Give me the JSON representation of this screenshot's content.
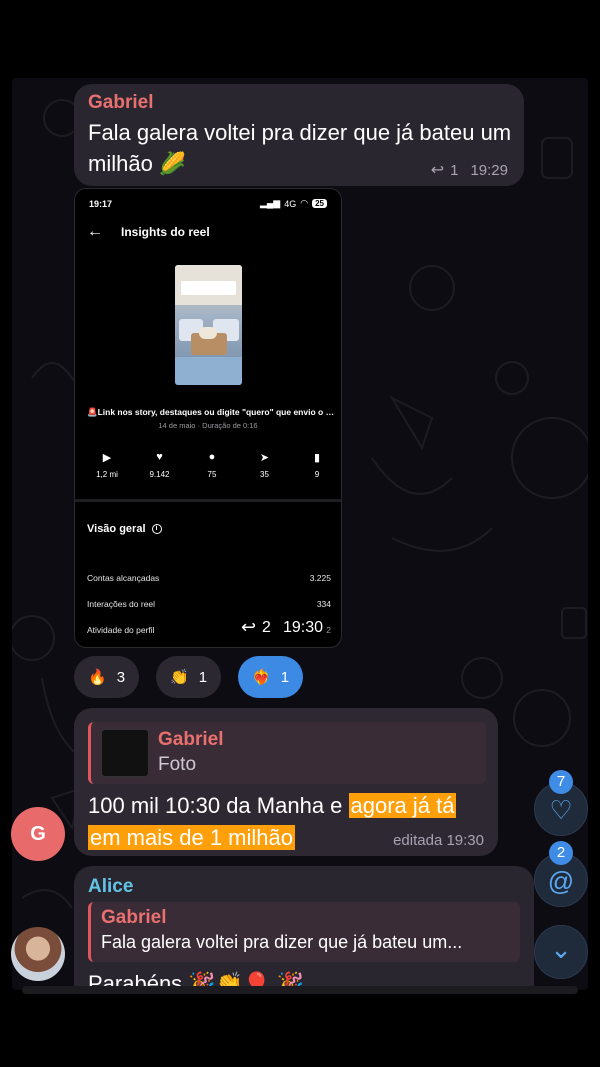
{
  "messages": {
    "first": {
      "sender": "Gabriel",
      "text": "Fala galera voltei pra dizer que já bateu um milhão 🌽",
      "reply_count": "1",
      "time": "19:29"
    },
    "screenshot": {
      "status_time": "19:17",
      "status_network": "4G",
      "status_battery": "25",
      "header_title": "Insights do reel",
      "caption": "🚨Link nos story, destaques ou digite \"quero\" que envio o li...",
      "date_line": "14 de maio · Duração de 0:16",
      "stats": [
        {
          "icon": "play-icon",
          "glyph": "▶",
          "value": "1,2 mi"
        },
        {
          "icon": "heart-icon",
          "glyph": "♥",
          "value": "9.142"
        },
        {
          "icon": "comment-icon",
          "glyph": "●",
          "value": "75"
        },
        {
          "icon": "share-icon",
          "glyph": "➤",
          "value": "35"
        },
        {
          "icon": "bookmark-icon",
          "glyph": "▮",
          "value": "9"
        }
      ],
      "overview_title": "Visão geral",
      "rows": [
        {
          "label": "Contas alcançadas",
          "value": "3.225"
        },
        {
          "label": "Interações do reel",
          "value": "334"
        },
        {
          "label": "Atividade do perfil",
          "value": "2"
        }
      ],
      "reply_count": "2",
      "time": "19:30"
    },
    "reactions": [
      {
        "emoji": "🔥",
        "count": "3"
      },
      {
        "emoji": "👏",
        "count": "1"
      },
      {
        "emoji": "❤️‍🔥",
        "count": "1"
      }
    ],
    "second": {
      "avatar_letter": "G",
      "quote_sender": "Gabriel",
      "quote_text": "Foto",
      "text_plain": "100 mil 10:30 da Manha e ",
      "text_hl1": "agora já tá",
      "text_hl2": "em mais de 1 milhão",
      "edited_label": "editada 19:30"
    },
    "third": {
      "sender": "Alice",
      "quote_sender": "Gabriel",
      "quote_text": "Fala galera voltei pra dizer que já bateu um...",
      "text": "Parabéns 🎉👏🎈 🎉"
    }
  },
  "fabs": {
    "reactions_badge": "7",
    "mentions_badge": "2",
    "heart_glyph": "♡",
    "mention_glyph": "@",
    "down_glyph": "⌄"
  },
  "colors": {
    "gabriel": "#e8706f",
    "alice": "#62c3e7",
    "highlight": "#ff9f0a",
    "accent": "#3f8ce6"
  }
}
